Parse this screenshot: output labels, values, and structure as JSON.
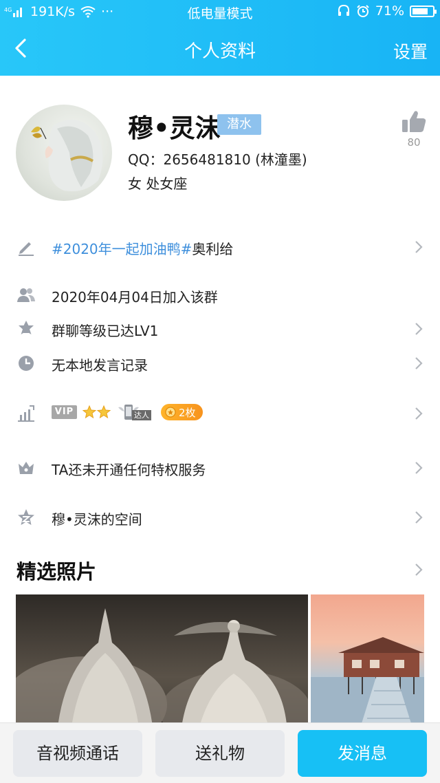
{
  "status_bar": {
    "network": "4G",
    "speed": "191K/s",
    "more": "···",
    "mode": "低电量模式",
    "battery": "71%",
    "battery_level": 0.71
  },
  "nav": {
    "title": "个人资料",
    "right": "设置"
  },
  "profile": {
    "name": "穆•灵沫",
    "badge": "潜水",
    "qq": "QQ：2656481810 (林潼墨)",
    "gender_sign": "女  处女座",
    "likes": "80"
  },
  "rows": {
    "signature_tag": "#2020年一起加油鸭#",
    "signature_rest": "奥利给",
    "joined": "2020年04月04日加入该群",
    "level": "群聊等级已达LV1",
    "history": "无本地发言记录",
    "privilege": "TA还未开通任何特权服务",
    "space": "穆•灵沫的空间"
  },
  "badges": {
    "vip": "VIP",
    "daren": "达人",
    "coins": "2枚"
  },
  "photos_section": {
    "title": "精选照片"
  },
  "actions": {
    "call": "音视频通话",
    "gift": "送礼物",
    "message": "发消息"
  },
  "colors": {
    "header": "#1cbcf7",
    "badge": "#8ec2ee",
    "link": "#3e8fdc",
    "primary_button": "#17c0f5"
  }
}
